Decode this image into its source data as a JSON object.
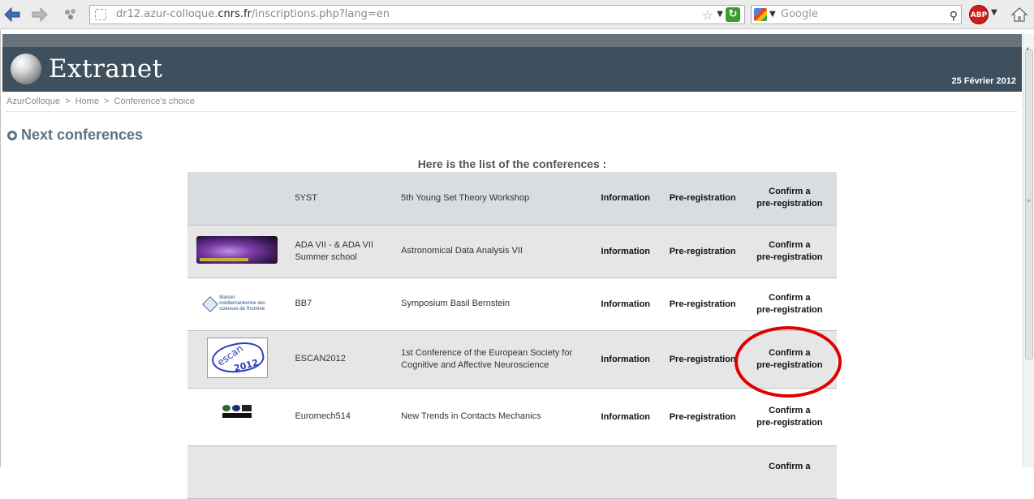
{
  "browser": {
    "url_prefix": "dr12.azur-colloque.",
    "url_domain": "cnrs.fr",
    "url_path": "/inscriptions.php?lang=en",
    "search_placeholder": "Google",
    "abp_label": "ABP"
  },
  "header": {
    "brand": "Extranet",
    "date": "25 Février 2012"
  },
  "breadcrumb": {
    "items": [
      "AzurColloque",
      "Home",
      "Conference's choice"
    ],
    "separator": ">"
  },
  "section": {
    "heading": "Next conferences",
    "list_title": "Here is the list of the conferences :"
  },
  "conferences": [
    {
      "acronym": "5YST",
      "title": "5th Young Set Theory Workshop",
      "info": "Information",
      "prereg": "Pre-registration",
      "confirm_1": "Confirm a",
      "confirm_2": "pre-registration"
    },
    {
      "acronym": "ADA VII - & ADA VII Summer school",
      "title": "Astronomical Data Analysis VII",
      "info": "Information",
      "prereg": "Pre-registration",
      "confirm_1": "Confirm a",
      "confirm_2": "pre-registration"
    },
    {
      "acronym": "BB7",
      "title": "Symposium Basil Bernstein",
      "info": "Information",
      "prereg": "Pre-registration",
      "confirm_1": "Confirm a",
      "confirm_2": "pre-registration"
    },
    {
      "acronym": "ESCAN2012",
      "title": "1st Conference of the European Society for Cognitive and Affective Neuroscience",
      "info": "Information",
      "prereg": "Pre-registration",
      "confirm_1": "Confirm a",
      "confirm_2": "pre-registration"
    },
    {
      "acronym": "Euromech514",
      "title": "New Trends in Contacts Mechanics",
      "info": "Information",
      "prereg": "Pre-registration",
      "confirm_1": "Confirm a",
      "confirm_2": "pre-registration"
    },
    {
      "acronym": "",
      "title": "",
      "info": "",
      "prereg": "",
      "confirm_1": "Confirm a",
      "confirm_2": ""
    }
  ],
  "logos": {
    "mmsh_text": "Maison méditerranéenne des sciences de l'homme",
    "escan_text": "escan",
    "escan_year": "2012"
  },
  "colors": {
    "banner": "#3e505d",
    "heading": "#5e7281",
    "annotation": "#e00000"
  }
}
